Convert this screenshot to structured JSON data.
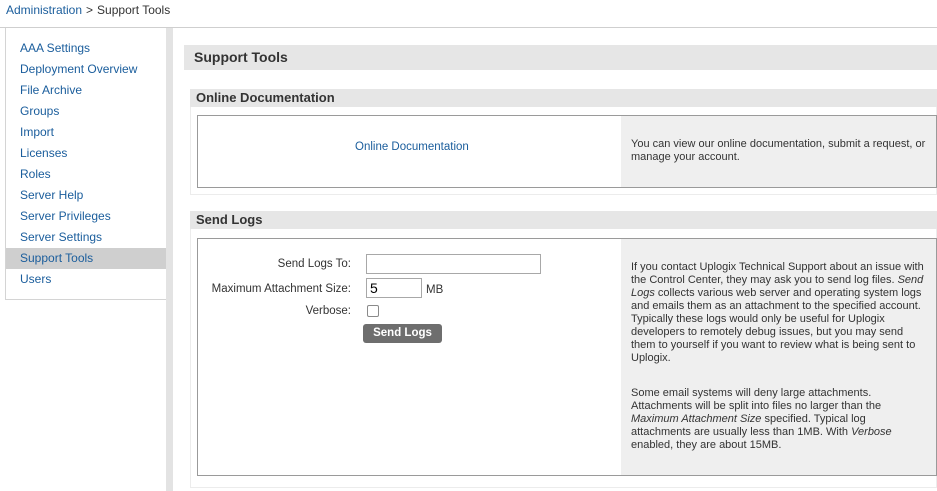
{
  "breadcrumb": {
    "root": "Administration",
    "separator": ">",
    "current": "Support Tools"
  },
  "sidebar": {
    "items": [
      {
        "label": "AAA Settings"
      },
      {
        "label": "Deployment Overview"
      },
      {
        "label": "File Archive"
      },
      {
        "label": "Groups"
      },
      {
        "label": "Import"
      },
      {
        "label": "Licenses"
      },
      {
        "label": "Roles"
      },
      {
        "label": "Server Help"
      },
      {
        "label": "Server Privileges"
      },
      {
        "label": "Server Settings"
      },
      {
        "label": "Support Tools",
        "active": true
      },
      {
        "label": "Users"
      }
    ]
  },
  "page": {
    "title": "Support Tools"
  },
  "online_docs": {
    "header": "Online Documentation",
    "link": "Online Documentation",
    "help": "You can view our online documentation, submit a request, or manage your account."
  },
  "send_logs": {
    "header": "Send Logs",
    "send_to_label": "Send Logs To:",
    "send_to_value": "",
    "max_size_label": "Maximum Attachment Size:",
    "max_size_value": "5",
    "max_size_unit": "MB",
    "verbose_label": "Verbose:",
    "verbose_checked": false,
    "button": "Send Logs",
    "help_p1_a": "If you contact Uplogix Technical Support about an issue with the Control Center, they may ask you to send log files. ",
    "help_p1_em": "Send Logs",
    "help_p1_b": " collects various web server and operating system logs and emails them as an attachment to the specified account. Typically these logs would only be useful for Uplogix developers to remotely debug issues, but you may send them to yourself if you want to review what is being sent to Uplogix.",
    "help_p2_a": "Some email systems will deny large attachments. Attachments will be split into files no larger than the ",
    "help_p2_em1": "Maximum Attachment Size",
    "help_p2_b": " specified. Typical log attachments are usually less than 1MB. With ",
    "help_p2_em2": "Verbose",
    "help_p2_c": " enabled, they are about 15MB."
  },
  "colors": {
    "link": "#1a5d9c",
    "header_bg": "#e6e6e6",
    "help_bg": "#efefef",
    "button_bg": "#6e6e6e"
  }
}
